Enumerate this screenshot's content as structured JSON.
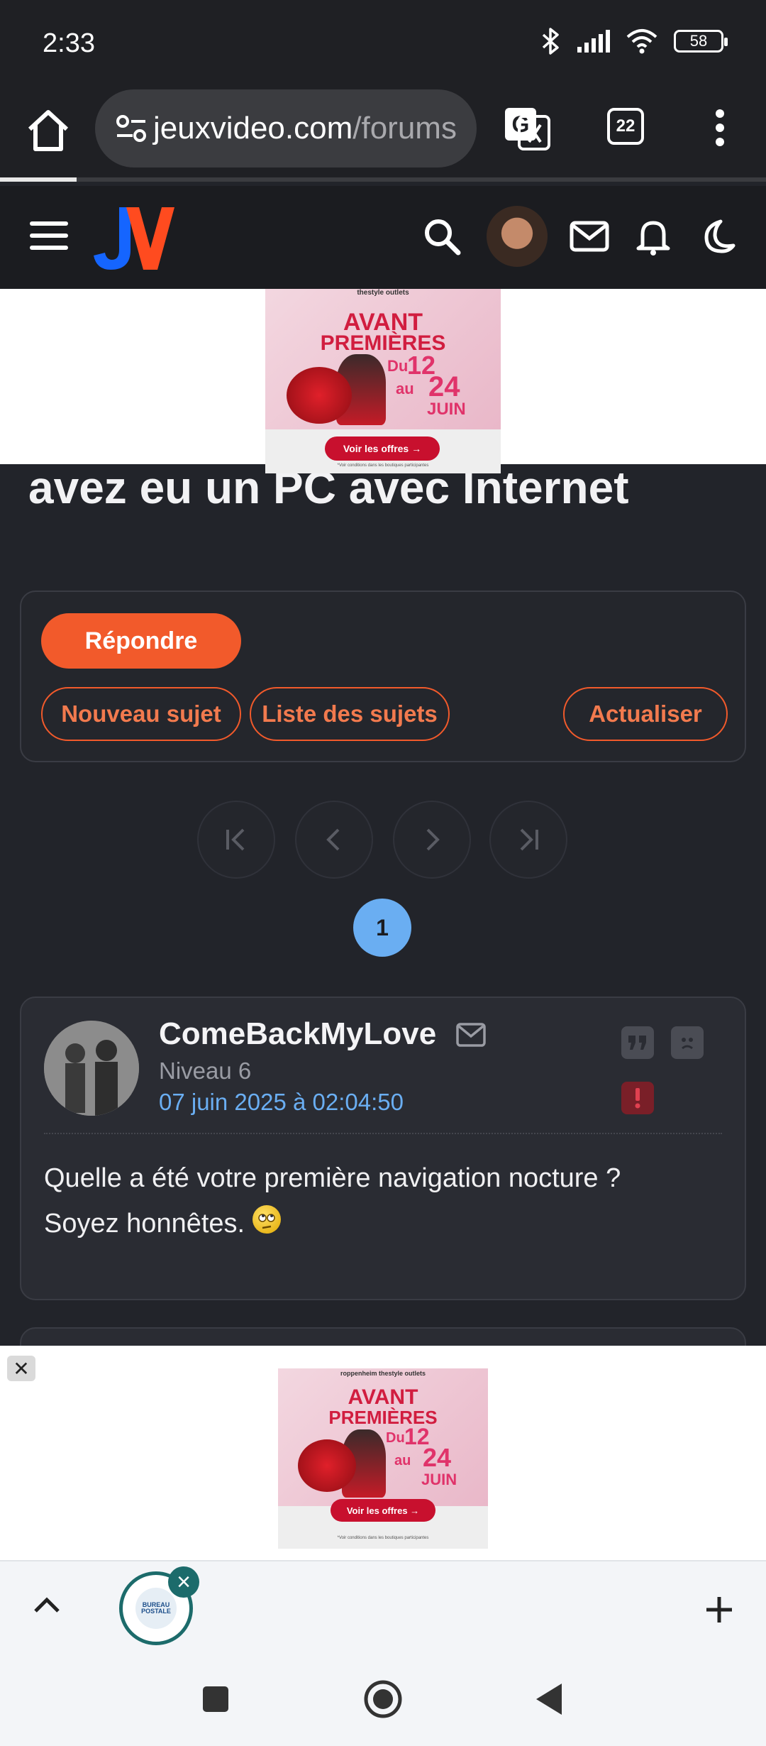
{
  "status_bar": {
    "time": "2:33",
    "battery": "58"
  },
  "browser": {
    "url_main": "jeuxvideo.com",
    "url_path": "/forums",
    "tab_count": "22"
  },
  "site": {
    "logo_text": "JV"
  },
  "ad": {
    "brand": "thestyle outlets",
    "brand_bottom": "roppenheim thestyle outlets",
    "headline_1": "AVANT",
    "headline_2": "PREMIÈRES",
    "du": "Du",
    "day_start": "12",
    "au": "au",
    "day_end": "24",
    "month": "JUIN",
    "cta": "Voir les offres →",
    "disclaimer": "*Voir conditions dans les boutiques participantes"
  },
  "topic": {
    "title_fragment": "avez eu un PC avec Internet"
  },
  "actions": {
    "reply": "Répondre",
    "new_topic": "Nouveau sujet",
    "topic_list": "Liste des sujets",
    "refresh": "Actualiser"
  },
  "pagination": {
    "current_page": "1"
  },
  "post": {
    "author": "ComeBackMyLove",
    "level": "Niveau 6",
    "date": "07 juin 2025 à 02:04:50",
    "line_1": "Quelle a été votre première navigation nocture ?",
    "line_2": "Soyez honnêtes."
  },
  "bottom_ad": {
    "close_label": "✕"
  },
  "tab_strip": {
    "tab_favicon_text": "BUREAU POSTALE"
  },
  "colors": {
    "accent": "#f25a2b",
    "link_blue": "#6aaef2",
    "background": "#22242a",
    "teal": "#1c6b6b"
  }
}
